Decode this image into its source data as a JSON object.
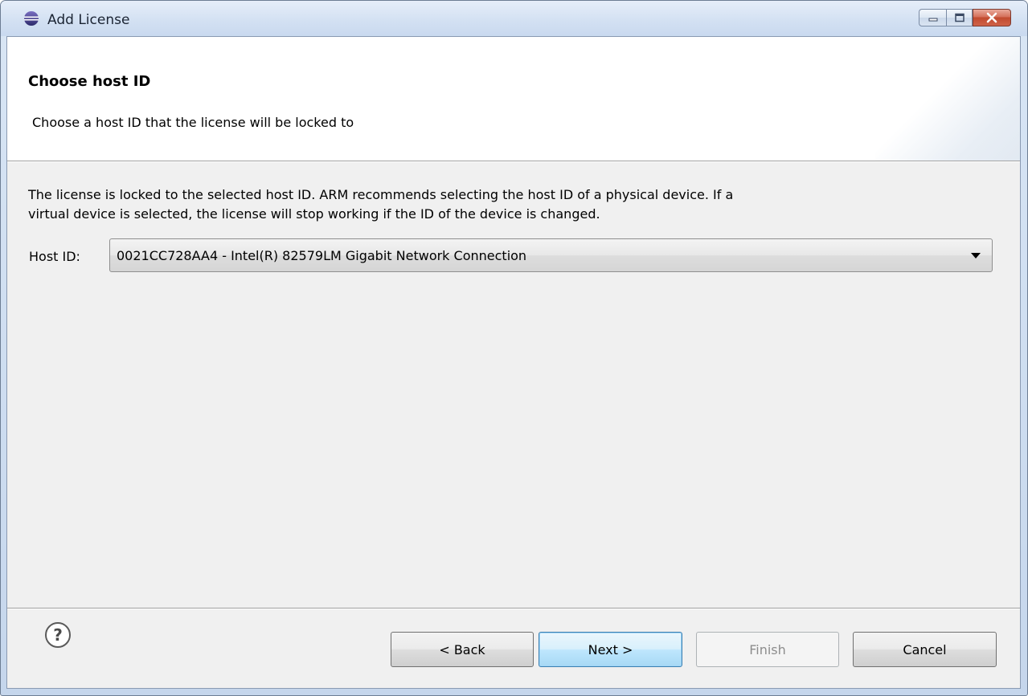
{
  "window": {
    "title": "Add License"
  },
  "banner": {
    "title": "Choose host ID",
    "description": "Choose a host ID that the license will be locked to"
  },
  "body": {
    "info_line1": "The license is locked to the selected host ID. ARM recommends selecting the host ID of a physical device. If a",
    "info_line2": "virtual device is selected, the license will stop working if the ID of the device is changed.",
    "host_label": "Host ID:",
    "host_value": "0021CC728AA4 - Intel(R) 82579LM Gigabit Network Connection"
  },
  "footer": {
    "help_glyph": "?",
    "back": "< Back",
    "next": "Next >",
    "finish": "Finish",
    "cancel": "Cancel"
  },
  "icons": [
    "eclipse-logo-icon",
    "minimize-icon",
    "maximize-icon",
    "close-icon",
    "help-icon",
    "dropdown-arrow-icon"
  ],
  "colors": {
    "default_button_border": "#3c7fb1",
    "disabled_text": "#8d8d8d",
    "close_button": "#c14a2f"
  },
  "state": {
    "finish_enabled": false
  }
}
